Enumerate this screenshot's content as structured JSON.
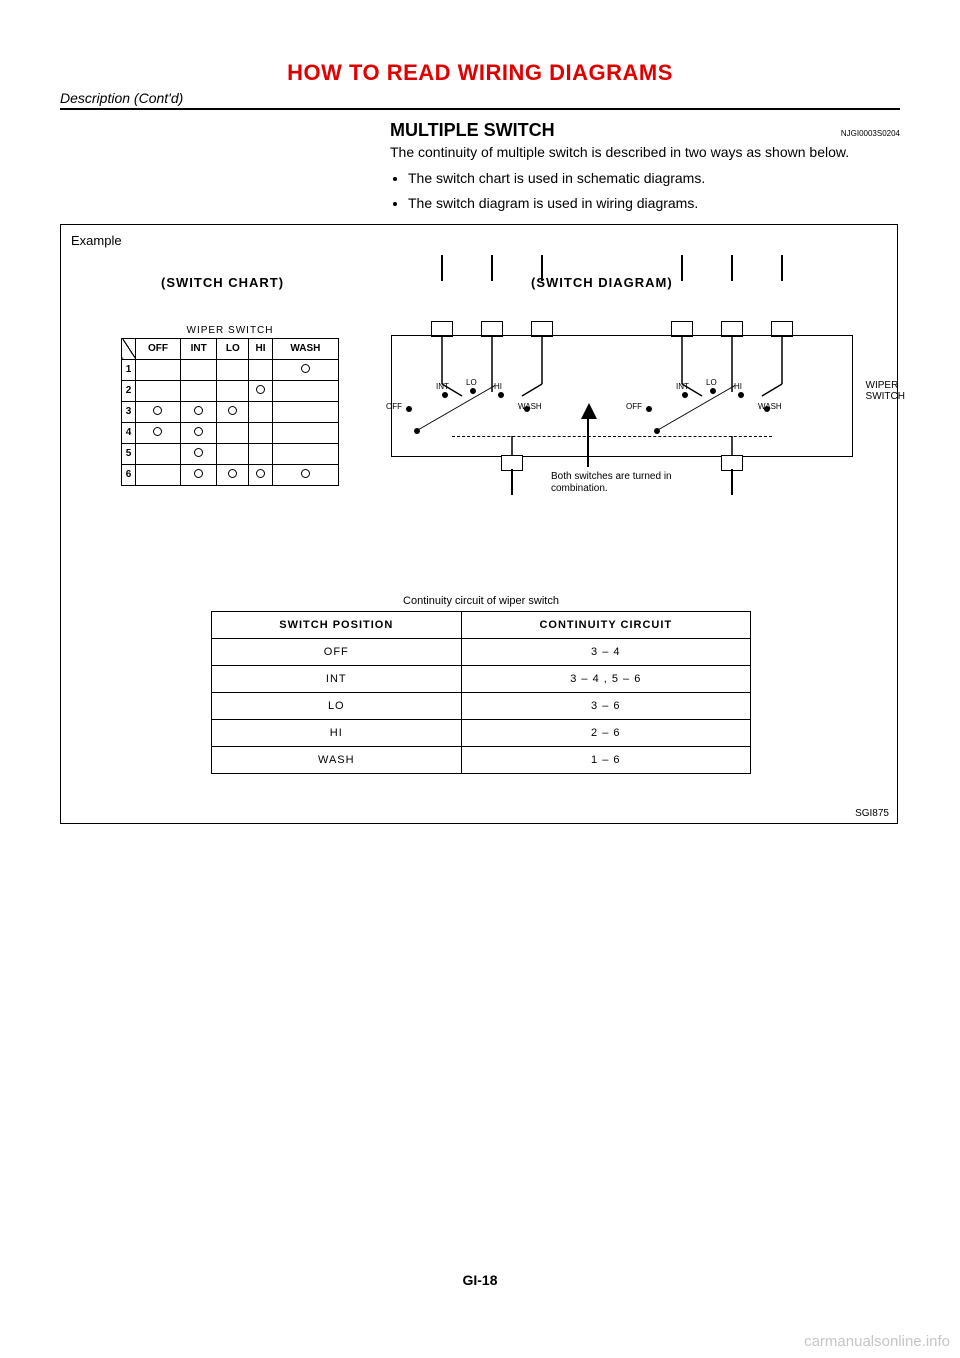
{
  "section_title": "HOW TO READ WIRING DIAGRAMS",
  "subhead": "Description (Cont'd)",
  "heading": "MULTIPLE SWITCH",
  "heading_ref": "NJGI0003S0204",
  "intro": "The continuity of multiple switch is described in two ways as shown below.",
  "bullets": [
    "The switch chart is used in schematic diagrams.",
    "The switch diagram is used in wiring diagrams."
  ],
  "figure": {
    "example": "Example",
    "left_title": "(SWITCH CHART)",
    "right_title": "(SWITCH DIAGRAM)",
    "figure_code": "SGI875",
    "switch_chart": {
      "caption": "WIPER SWITCH",
      "cols": [
        "OFF",
        "INT",
        "LO",
        "HI",
        "WASH"
      ],
      "rows": [
        "1",
        "2",
        "3",
        "4",
        "5",
        "6"
      ],
      "marks": {
        "1": {
          "WASH": true
        },
        "2": {
          "HI": true
        },
        "3": {
          "OFF": true,
          "INT": true,
          "LO": true
        },
        "4": {
          "OFF": true,
          "INT": true
        },
        "5": {
          "INT": true
        },
        "6": {
          "INT": true,
          "LO": true,
          "HI": true,
          "WASH": true
        }
      }
    },
    "rotary_labels": {
      "off": "OFF",
      "int": "INT",
      "lo": "LO",
      "hi": "HI",
      "wash": "WASH"
    },
    "side_label_l1": "WIPER",
    "side_label_l2": "SWITCH",
    "note_l1": "Both switches are turned in",
    "note_l2": "combination.",
    "continuity": {
      "caption": "Continuity circuit of wiper switch",
      "head_left": "SWITCH POSITION",
      "head_right": "CONTINUITY CIRCUIT",
      "rows": [
        {
          "pos": "OFF",
          "cir": "3 – 4"
        },
        {
          "pos": "INT",
          "cir": "3 – 4 , 5 – 6"
        },
        {
          "pos": "LO",
          "cir": "3 – 6"
        },
        {
          "pos": "HI",
          "cir": "2 – 6"
        },
        {
          "pos": "WASH",
          "cir": "1 – 6"
        }
      ]
    }
  },
  "page_number": "GI-18",
  "watermark": "carmanualsonline.info"
}
